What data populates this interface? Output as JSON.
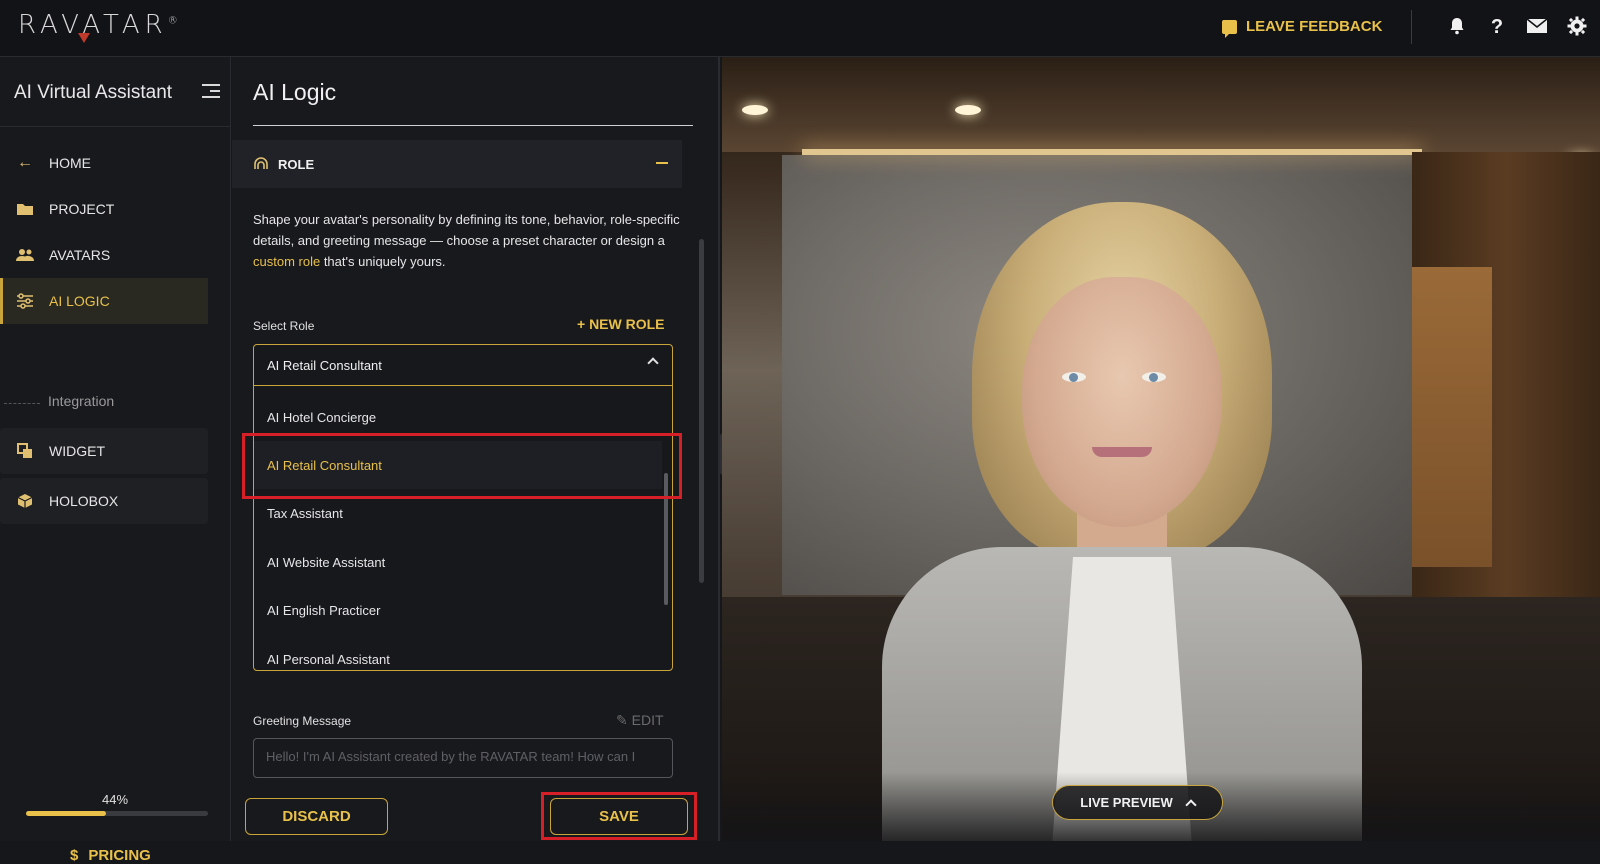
{
  "header": {
    "logo_text": "RAVATAR",
    "logo_mark": "®",
    "feedback_label": "LEAVE FEEDBACK",
    "icons": [
      "bell-icon",
      "help-icon",
      "mail-icon",
      "gear-icon"
    ]
  },
  "sidebar": {
    "title": "AI Virtual Assistant",
    "items": [
      {
        "label": "HOME",
        "icon": "arrow-left-icon"
      },
      {
        "label": "PROJECT",
        "icon": "folder-icon"
      },
      {
        "label": "AVATARS",
        "icon": "users-icon"
      },
      {
        "label": "AI LOGIC",
        "icon": "sliders-icon"
      },
      {
        "label": "Integration",
        "icon": ""
      },
      {
        "label": "WIDGET",
        "icon": "widget-icon"
      },
      {
        "label": "HOLOBOX",
        "icon": "box-icon"
      }
    ],
    "progress_text": "44%",
    "progress_value": 0.44,
    "pricing_label": "PRICING",
    "pricing_symbol": "$"
  },
  "panel": {
    "title": "AI Logic",
    "section_title": "ROLE",
    "description_before": "Shape your avatar's personality by defining its tone, behavior, role-specific details, and greeting message — choose a preset character or design a ",
    "description_link": "custom role",
    "description_after": " that's uniquely yours.",
    "select_label": "Select Role",
    "new_role_label": "+  NEW ROLE",
    "selected_value": "AI Retail Consultant",
    "options": [
      "AI Hotel Concierge",
      "AI Retail Consultant",
      "Tax Assistant",
      "AI Website Assistant",
      "AI English Practicer",
      "AI Personal Assistant"
    ],
    "greeting_label": "Greeting Message",
    "edit_label": "EDIT",
    "greeting_text": "Hello! I'm AI Assistant created by the RAVATAR team! How can I",
    "discard_label": "DISCARD",
    "save_label": "SAVE"
  },
  "preview": {
    "live_preview_label": "LIVE PREVIEW"
  },
  "colors": {
    "accent": "#e8c04a",
    "highlight_box": "#d61f26",
    "background": "#18191d"
  }
}
